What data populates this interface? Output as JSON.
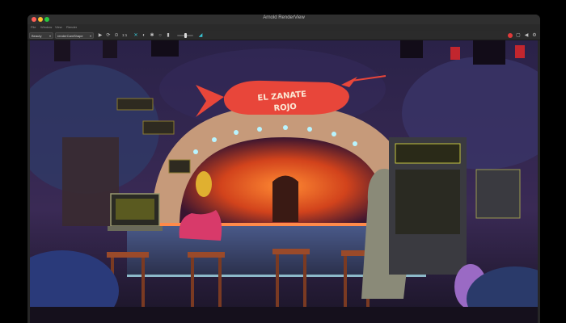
{
  "window": {
    "title": "Arnold RenderView"
  },
  "menu": [
    "File",
    "Window",
    "View",
    "Render"
  ],
  "toolbar": {
    "renderer_select": "Beauty",
    "camera_select": "renderCamShape",
    "ratio_label": "1:1"
  },
  "icons": {
    "refresh": "refresh-icon",
    "stop": "stop-icon",
    "snapshot": "camera-icon",
    "color": "color-icon",
    "settings": "gear-icon"
  },
  "scene": {
    "sign_line1": "EL ZANATE",
    "sign_line2": "ROJO"
  },
  "colors": {
    "accent_red": "#e03a3a",
    "sign_red": "#e8463a",
    "arch_glow": "#ff7a2f"
  }
}
